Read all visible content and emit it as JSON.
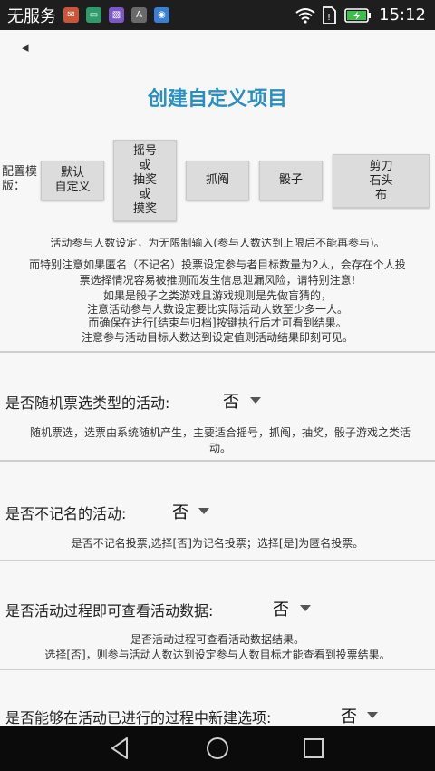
{
  "status_bar": {
    "carrier": "无服务",
    "time": "15:12",
    "app_icons": [
      "message-app-icon",
      "chat-app-icon",
      "gallery-app-icon",
      "font-app-icon",
      "browser-app-icon"
    ]
  },
  "header": {
    "back_symbol": "◂",
    "title": "创建自定义项目"
  },
  "templates": {
    "label": "配置模版：",
    "buttons": [
      {
        "label": "默认\n自定义"
      },
      {
        "label": "摇号\n或\n抽奖\n或\n摸奖"
      },
      {
        "label": "抓阄"
      },
      {
        "label": "骰子"
      },
      {
        "label": "剪刀\n石头\n布"
      }
    ]
  },
  "notice_lines": [
    "活动参与人数设定，为无限制输入(参与人数达到上限后不能再参与)。",
    "而特别注意如果匿名（不记名）投票设定参与者目标数量为2人，会存在个人投",
    "票选择情况容易被推测而发生信息泄漏风险，请特别注意!",
    "如果是骰子之类游戏且游戏规则是先做盲猜的，",
    "注意活动参与人数设定要比实际活动人数至少多一人。",
    "而确保在进行[结束与归档]按键执行后才可看到结果。",
    "注意参与活动目标人数达到设定值则活动结果即刻可见。"
  ],
  "questions": [
    {
      "label": "是否随机票选类型的活动:",
      "value": "否",
      "desc": [
        "随机票选，选票由系统随机产生，主要适合摇号，抓阄，抽奖，骰子游戏之类活",
        "动。"
      ]
    },
    {
      "label": "是否不记名的活动:",
      "value": "否",
      "desc": [
        "是否不记名投票,选择[否]为记名投票；选择[是]为匿名投票。"
      ]
    },
    {
      "label": "是否活动过程即可查看活动数据:",
      "value": "否",
      "desc": [
        "是否活动过程可查看活动数据结果。",
        "选择[否]，则参与活动人数达到设定参与人数目标才能查看到投票结果。"
      ]
    },
    {
      "label": "是否能够在活动已进行的过程中新建选项:",
      "value": "否",
      "desc": []
    }
  ],
  "nav": {
    "icons": [
      "back-nav-icon",
      "home-nav-icon",
      "recents-nav-icon"
    ]
  },
  "colors": {
    "title": "#2a8fbf",
    "status_bar": "#1e1e1e",
    "nav_bar": "#0b0b0b",
    "button_bg": "#dcdcdc"
  }
}
